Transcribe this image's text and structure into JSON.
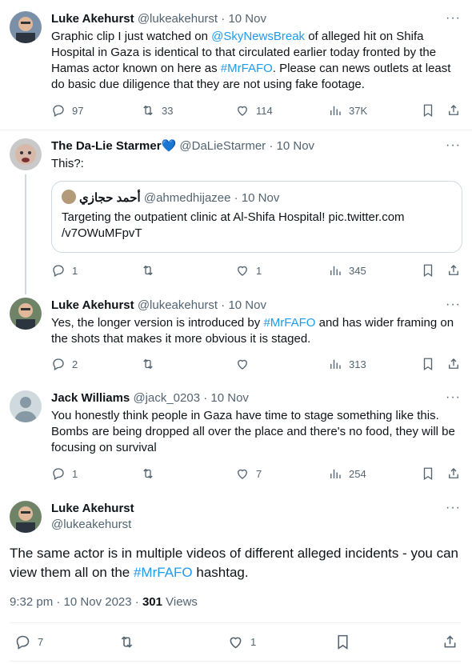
{
  "tweets": [
    {
      "name": "Luke Akehurst",
      "handle": "@lukeakehurst",
      "date": "10 Nov",
      "text_parts": [
        "Graphic clip I just watched on ",
        "@SkyNewsBreak",
        "  of alleged hit on Shifa Hospital in Gaza is identical to that circulated earlier today fronted by the Hamas actor known on here as ",
        "#MrFAFO",
        ". Please can news outlets at least do basic due diligence that they are not using fake footage."
      ],
      "replies": "97",
      "retweets": "33",
      "likes": "114",
      "views": "37K"
    },
    {
      "name": "The Da-Lie Starmer",
      "name_emoji": "💙",
      "handle": "@DaLieStarmer",
      "date": "10 Nov",
      "text": "This?:",
      "quote": {
        "name": "أحمد حجازي",
        "handle": "@ahmedhijazee",
        "date": "10 Nov",
        "text": "Targeting the outpatient clinic at Al-Shifa Hospital! pic.twitter.com /v7OWuMFpvT"
      },
      "replies": "1",
      "retweets": "",
      "likes": "1",
      "views": "345"
    },
    {
      "name": "Luke Akehurst",
      "handle": "@lukeakehurst",
      "date": "10 Nov",
      "text_parts": [
        "Yes, the longer version is introduced by ",
        "#MrFAFO",
        " and has wider framing on the shots that makes it more obvious it is staged."
      ],
      "replies": "2",
      "retweets": "",
      "likes": "",
      "views": "313"
    },
    {
      "name": "Jack Williams",
      "handle": "@jack_0203",
      "date": "10 Nov",
      "text": "You honestly think people in Gaza have time to stage something like this. Bombs are being dropped all over the place and there's no food, they will be focusing on survival",
      "replies": "1",
      "retweets": "",
      "likes": "7",
      "views": "254"
    }
  ],
  "main": {
    "name": "Luke Akehurst",
    "handle": "@lukeakehurst",
    "text_parts": [
      "The same actor is in multiple videos of different alleged incidents - you can view them all on the ",
      "#MrFAFO",
      " hashtag."
    ],
    "time": "9:32 pm",
    "date": "10 Nov 2023",
    "views_count": "301",
    "views_label": "Views",
    "replies": "7",
    "likes": "1"
  },
  "ui": {
    "separator": " · ",
    "more_glyph": "···"
  },
  "colors": {
    "link": "#1d9bf0",
    "muted": "#536471",
    "text": "#0f1419"
  },
  "icons": [
    "reply-icon",
    "retweet-icon",
    "like-icon",
    "views-icon",
    "bookmark-icon",
    "share-icon",
    "more-icon"
  ]
}
